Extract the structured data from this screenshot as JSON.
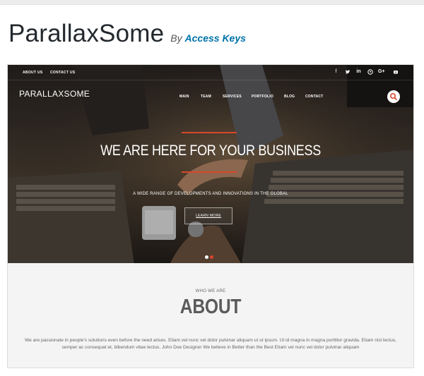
{
  "header": {
    "theme_title": "ParallaxSome",
    "by_label": "By",
    "author": "Access Keys"
  },
  "preview": {
    "topbar": {
      "links": [
        "ABOUT US",
        "CONTACT US"
      ],
      "social_icons": [
        "facebook-icon",
        "twitter-icon",
        "linkedin-icon",
        "pinterest-icon",
        "google-plus-icon",
        "youtube-icon"
      ]
    },
    "site_title": "PARALLAXSOME",
    "nav": [
      "MAIN",
      "TEAM",
      "SERVICES",
      "PORTFOLIO",
      "BLOG",
      "CONTACT"
    ],
    "hero": {
      "heading": "WE ARE HERE FOR YOUR BUSINESS",
      "subheading": "A WIDE RANGE OF DEVELOPMENTS AND INNOVATIONS IN THE GLOBAL",
      "button_label": "LEARN MORE",
      "slides_count": 2,
      "active_slide": 2
    },
    "about": {
      "eyebrow": "WHO WE ARE",
      "title": "ABOUT",
      "text": "We are passionate in people's solutions even before the need arises. Etiam vel nunc vel dolor pulvinar aliquam ut ut ipsum. Ut id magna in magna porttitor gravida. Etiam nisl lectus, semper ac consequat et, bibendum vitae lectus. John Doe Designer We believe in Better than the Best Etiam vel nunc vel dolor pulvinar aliquam"
    },
    "colors": {
      "accent": "#d9472b",
      "link": "#0073aa",
      "section_bg": "#f4f4f4"
    }
  }
}
